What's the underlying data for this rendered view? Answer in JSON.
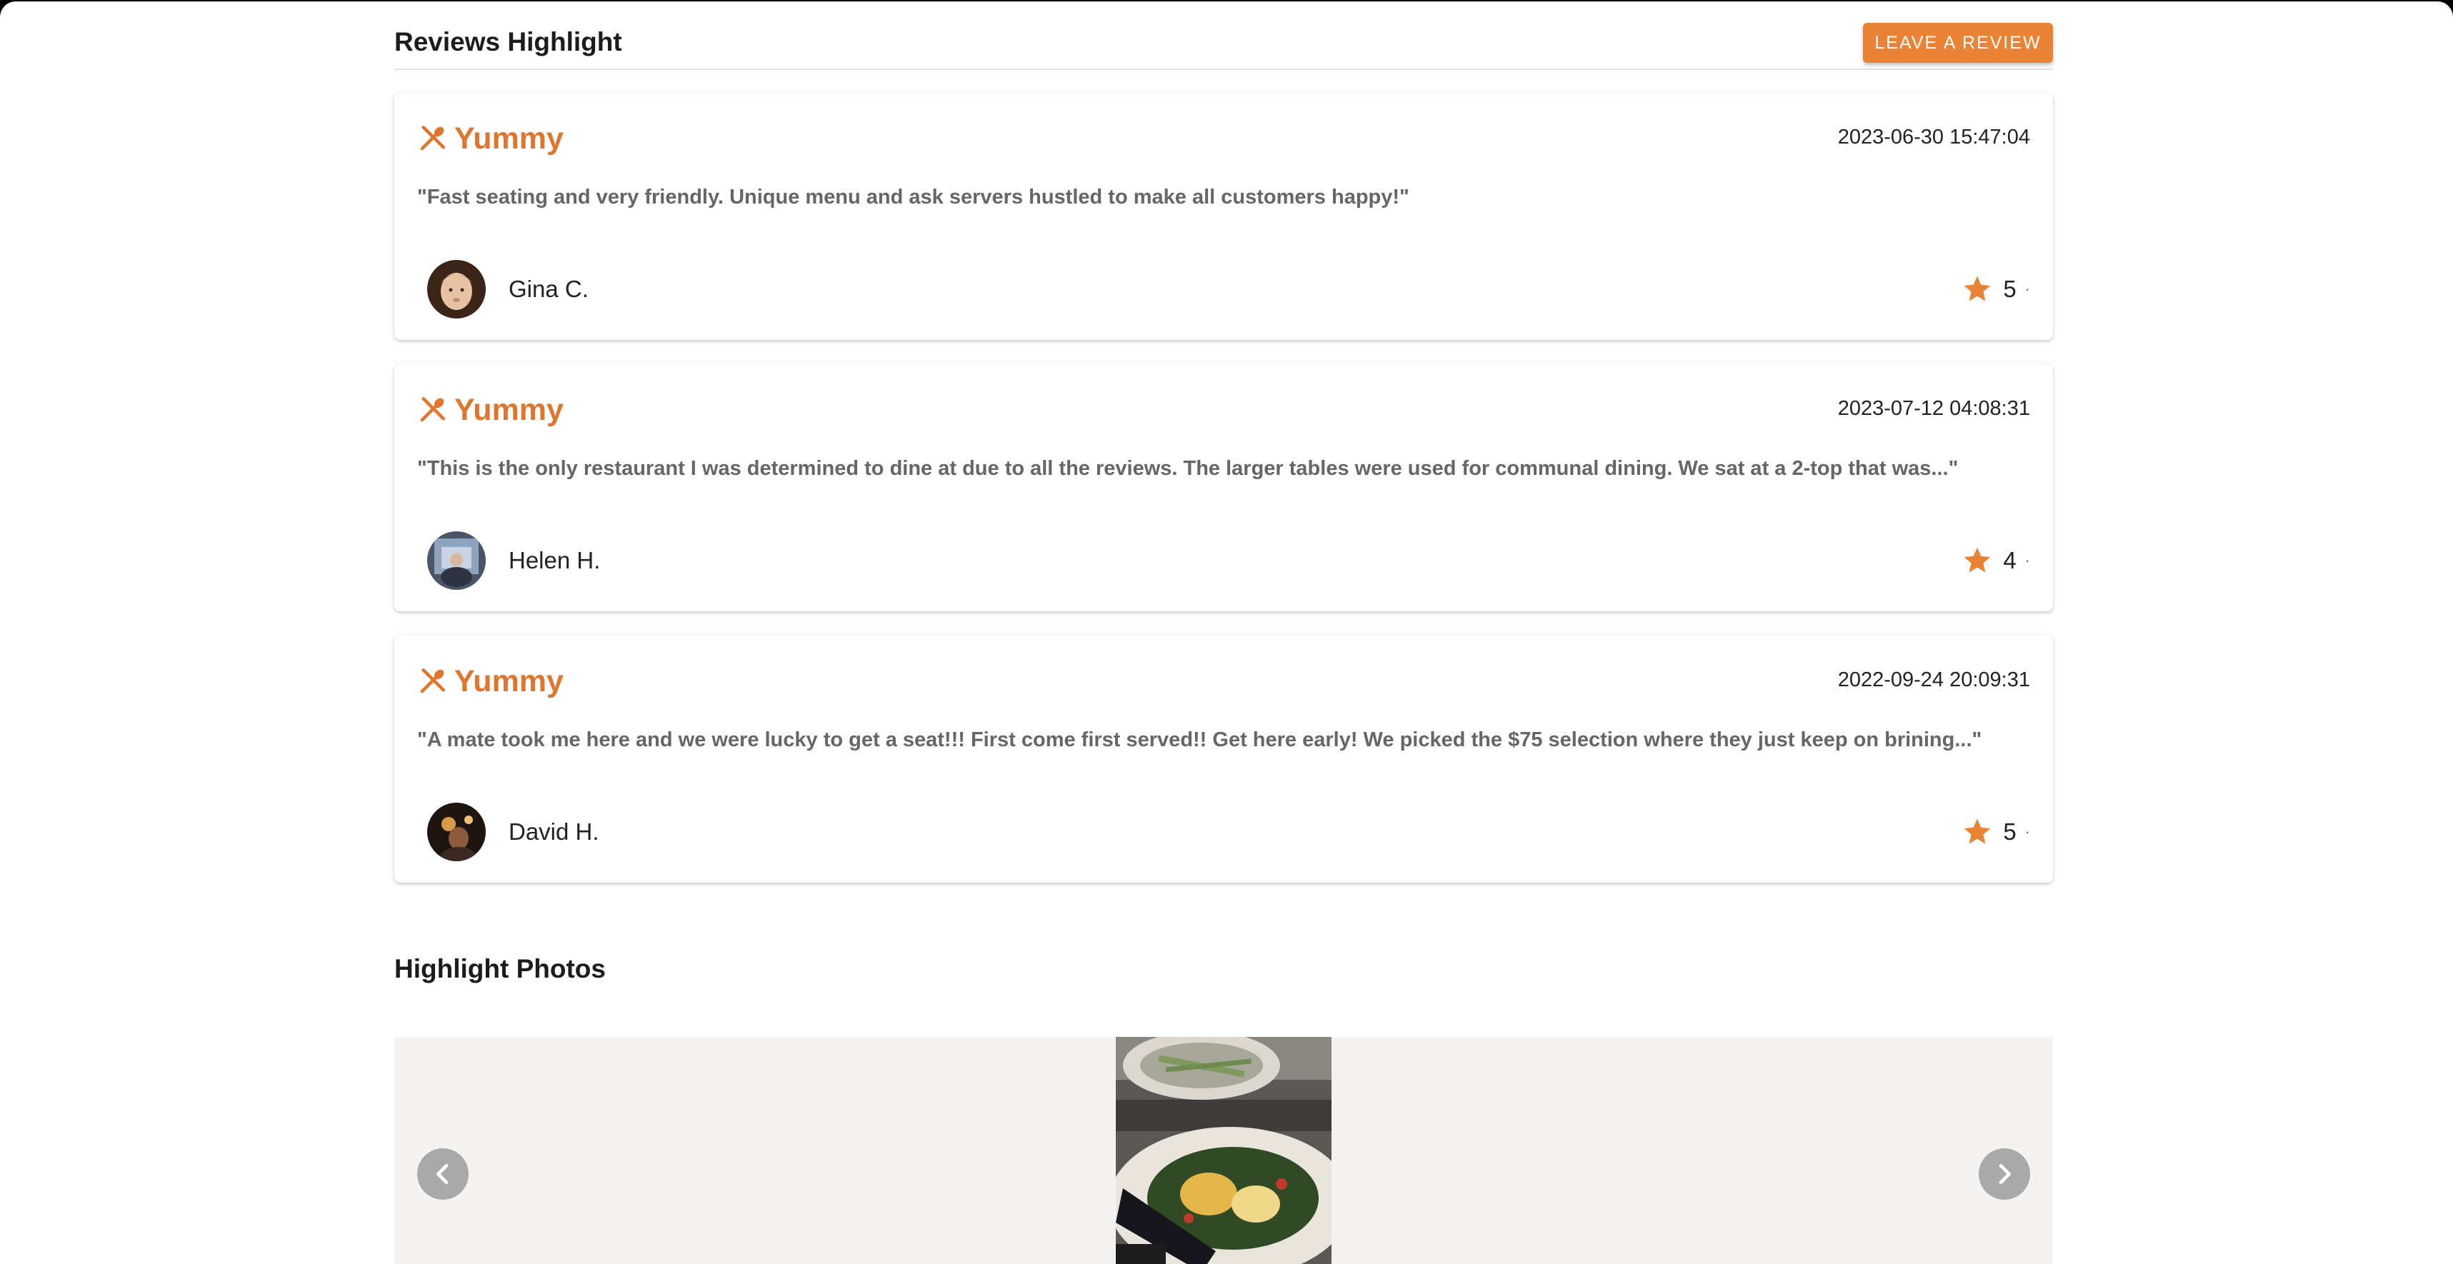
{
  "reviews_section": {
    "title": "Reviews Highlight",
    "leave_review_label": "LEAVE A REVIEW"
  },
  "reviews": [
    {
      "tag": "Yummy",
      "date": "2023-06-30 15:47:04",
      "text": "\"Fast seating and very friendly. Unique menu and ask servers hustled to make all customers happy!\"",
      "reviewer": "Gina C.",
      "rating": "5"
    },
    {
      "tag": "Yummy",
      "date": "2023-07-12 04:08:31",
      "text": "\"This is the only restaurant I was determined to dine at due to all the reviews. The larger tables were used for communal dining. We sat at a 2-top that was...\"",
      "reviewer": "Helen H.",
      "rating": "4"
    },
    {
      "tag": "Yummy",
      "date": "2022-09-24 20:09:31",
      "text": "\"A mate took me here and we were lucky to get a seat!!! First come first served!! Get here early! We picked the $75 selection where they just keep on brining...\"",
      "reviewer": "David H.",
      "rating": "5"
    }
  ],
  "photos_section": {
    "title": "Highlight Photos"
  },
  "colors": {
    "accent": "#ea8336",
    "tag_text": "#e0762e",
    "carousel_bg": "#f4f3f1",
    "carousel_button": "#a9a9a9"
  },
  "icons": {
    "tag": "utensils-icon",
    "rating": "star-icon",
    "carousel_prev": "chevron-left-icon",
    "carousel_next": "chevron-right-icon"
  }
}
